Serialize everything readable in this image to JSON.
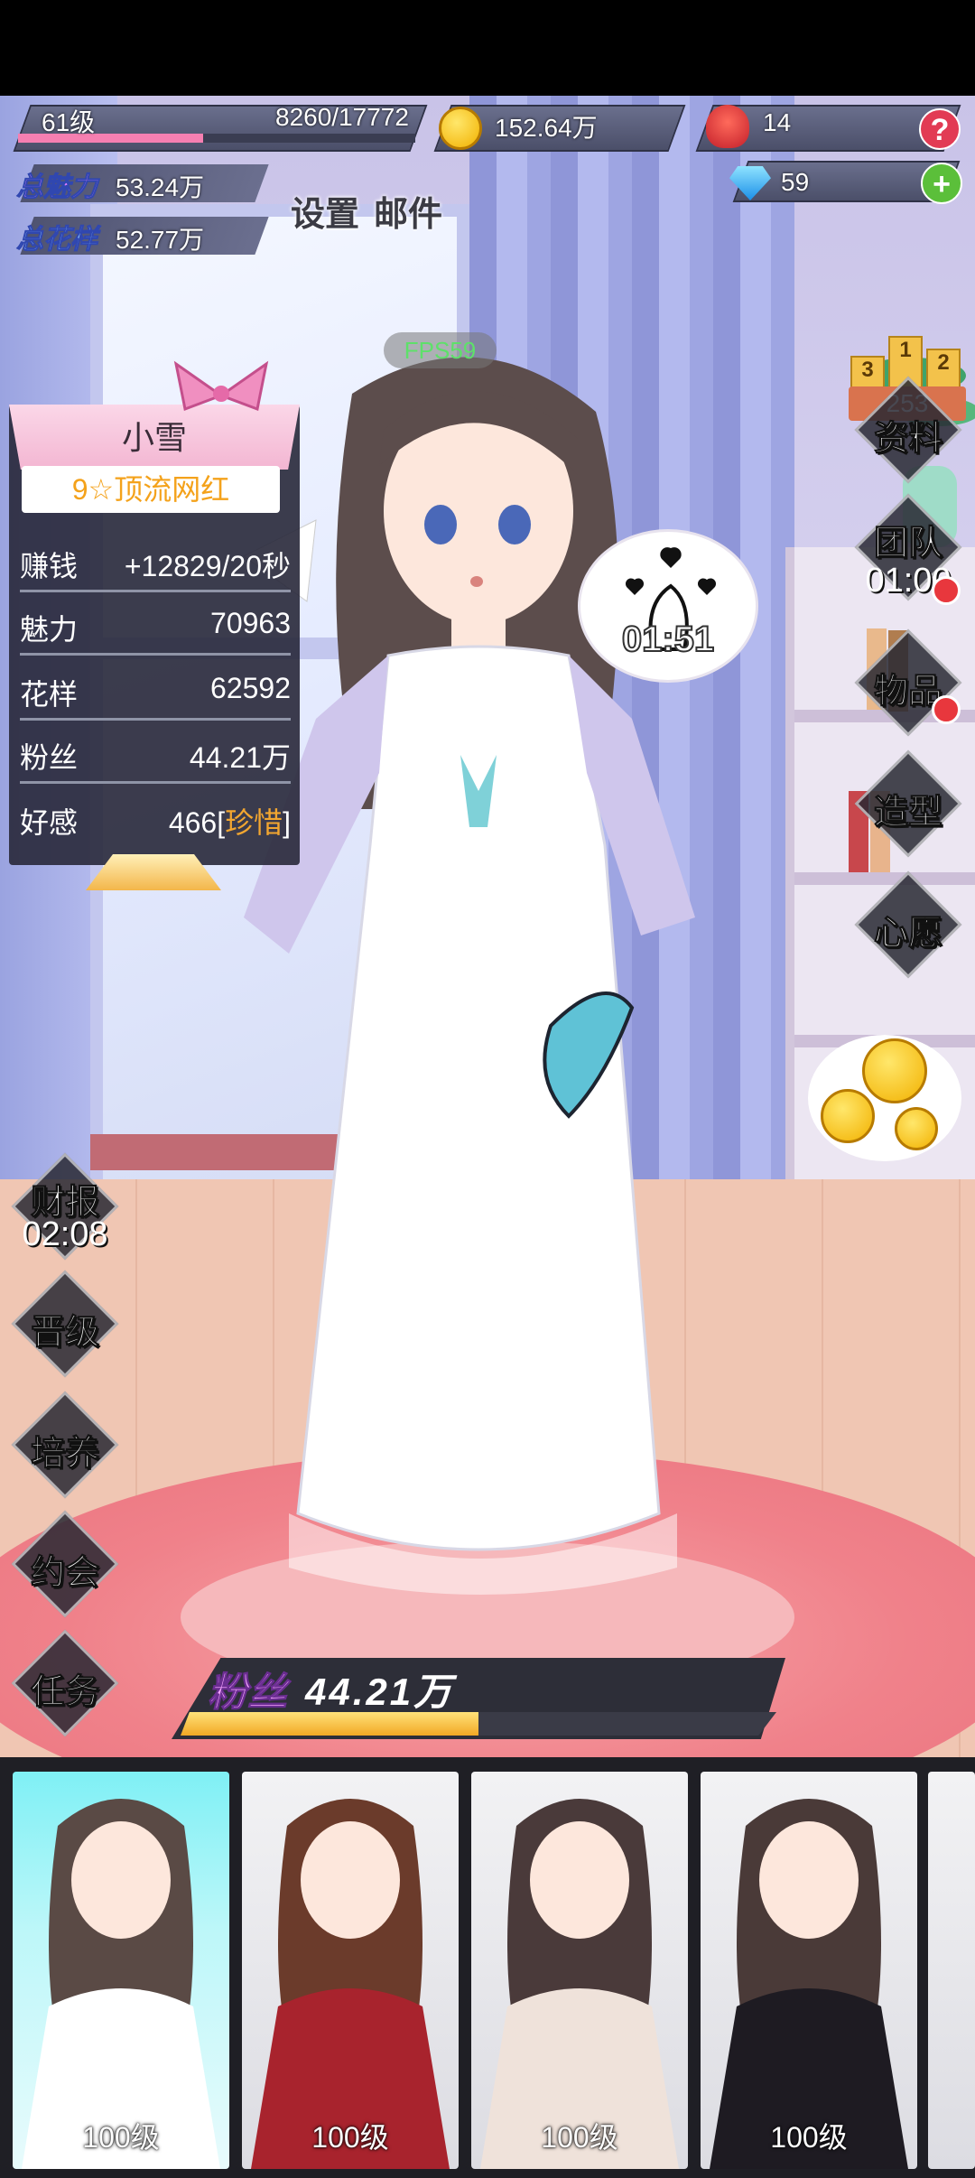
{
  "player": {
    "level": "61级",
    "exp": "8260/17772",
    "exp_fraction": 0.465,
    "gold": "152.64万",
    "roses": "14",
    "gems": "59",
    "help_glyph": "?",
    "add_glyph": "+"
  },
  "stats": {
    "charm_label": "总魅力",
    "charm_value": "53.24万",
    "style_label": "总花样",
    "style_value": "52.77万"
  },
  "top_buttons": {
    "settings": "设置",
    "mail": "邮件",
    "fps": "FPS59"
  },
  "ranking": {
    "podium": [
      "3",
      "1",
      "2"
    ],
    "rank": "253"
  },
  "profile": {
    "name": "小雪",
    "title": "9☆顶流网红",
    "rows": [
      {
        "key": "赚钱",
        "value": "+12829/20秒"
      },
      {
        "key": "魅力",
        "value": "70963"
      },
      {
        "key": "花样",
        "value": "62592"
      },
      {
        "key": "粉丝",
        "value": "44.21万"
      },
      {
        "key": "好感",
        "value": "466",
        "tag_open": "[",
        "tag": "珍惜",
        "tag_close": "]"
      }
    ]
  },
  "right_menu": {
    "info": "资料",
    "team": "团队",
    "team_timer": "01:00",
    "items": "物品",
    "styling": "造型",
    "wish": "心愿"
  },
  "left_menu": {
    "report": "财报",
    "report_timer": "02:08",
    "promote": "晋级",
    "train": "培养",
    "date": "约会",
    "quest": "任务"
  },
  "bubble": {
    "timer": "01:51",
    "icon": "finger-heart-icon"
  },
  "fans": {
    "label": "粉丝",
    "value": "44.21万",
    "progress": 0.5
  },
  "cards": [
    {
      "level": "100级",
      "hair": "#5a4a45",
      "outfit": "#ffffff",
      "selected": true
    },
    {
      "level": "100级",
      "hair": "#6b3b2b",
      "outfit": "#a8232d",
      "selected": false
    },
    {
      "level": "100级",
      "hair": "#4a3a3a",
      "outfit": "#efe2da",
      "selected": false
    },
    {
      "level": "100级",
      "hair": "#4a3a38",
      "outfit": "#1e1b22",
      "selected": false
    }
  ],
  "colors": {
    "accent_pink": "#f67fb1",
    "gold": "#f2a630",
    "panel": "#28283a"
  }
}
